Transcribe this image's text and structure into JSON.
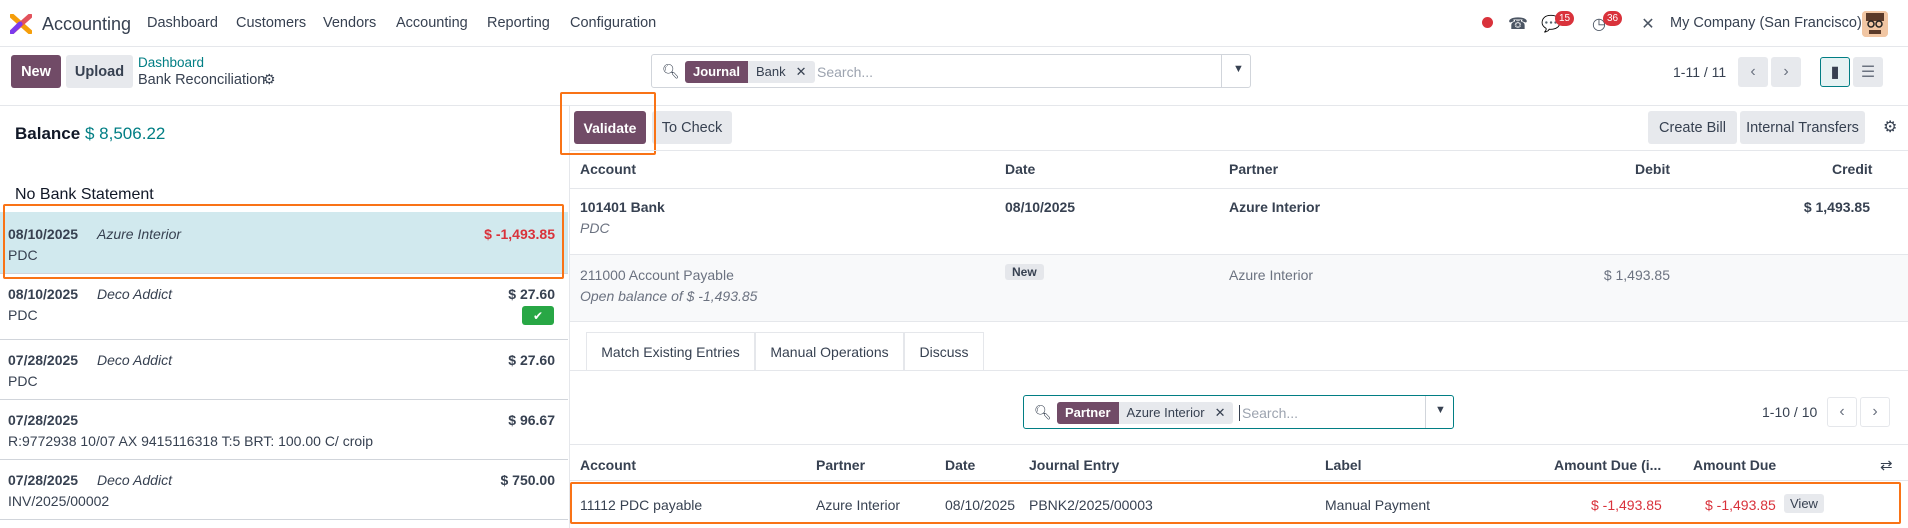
{
  "app": {
    "name": "Accounting"
  },
  "nav": {
    "items": [
      "Dashboard",
      "Customers",
      "Vendors",
      "Accounting",
      "Reporting",
      "Configuration"
    ]
  },
  "systray": {
    "messages_count": "15",
    "activities_count": "36",
    "company": "My Company (San Francisco)"
  },
  "control": {
    "new_label": "New",
    "upload_label": "Upload",
    "breadcrumb_parent": "Dashboard",
    "breadcrumb_current": "Bank Reconciliation",
    "search": {
      "facet_key": "Journal",
      "facet_value": "Bank",
      "placeholder": "Search..."
    },
    "pager": "1-11 / 11"
  },
  "left_panel": {
    "balance_label": "Balance",
    "balance_value": "$ 8,506.22",
    "statement_label": "No Bank Statement",
    "lines": [
      {
        "date": "08/10/2025",
        "partner": "Azure Interior",
        "amount": "$ -1,493.85",
        "ref": "PDC",
        "selected": true,
        "reconciled": false
      },
      {
        "date": "08/10/2025",
        "partner": "Deco Addict",
        "amount": "$ 27.60",
        "ref": "PDC",
        "selected": false,
        "reconciled": true
      },
      {
        "date": "07/28/2025",
        "partner": "Deco Addict",
        "amount": "$ 27.60",
        "ref": "PDC",
        "selected": false,
        "reconciled": false
      },
      {
        "date": "07/28/2025",
        "partner": "",
        "amount": "$ 96.67",
        "ref": "R:9772938 10/07 AX 9415116318 T:5 BRT: 100.00 C/ croip",
        "selected": false,
        "reconciled": false
      },
      {
        "date": "07/28/2025",
        "partner": "Deco Addict",
        "amount": "$ 750.00",
        "ref": "INV/2025/00002",
        "selected": false,
        "reconciled": false
      }
    ]
  },
  "right_panel": {
    "validate_label": "Validate",
    "to_check_label": "To Check",
    "create_bill_label": "Create Bill",
    "internal_transfers_label": "Internal Transfers",
    "columns": {
      "account": "Account",
      "date": "Date",
      "partner": "Partner",
      "debit": "Debit",
      "credit": "Credit"
    },
    "entries": [
      {
        "account": "101401 Bank",
        "sub": "PDC",
        "date": "08/10/2025",
        "partner": "Azure Interior",
        "debit": "",
        "credit": "$ 1,493.85"
      },
      {
        "account": "211000 Account Payable",
        "sub": "Open balance of $ -1,493.85",
        "date_badge": "New",
        "partner": "Azure Interior",
        "debit": "$ 1,493.85",
        "credit": ""
      }
    ],
    "tabs": [
      "Match Existing Entries",
      "Manual Operations",
      "Discuss"
    ],
    "match_search": {
      "facet_key": "Partner",
      "facet_value": "Azure Interior",
      "placeholder": "Search..."
    },
    "match_pager": "1-10 / 10",
    "match_columns": {
      "account": "Account",
      "partner": "Partner",
      "date": "Date",
      "journal_entry": "Journal Entry",
      "label": "Label",
      "amount_due_i": "Amount Due (i...",
      "amount_due": "Amount Due"
    },
    "match_rows": [
      {
        "account": "11112 PDC payable",
        "partner": "Azure Interior",
        "date": "08/10/2025",
        "journal_entry": "PBNK2/2025/00003",
        "label": "Manual Payment",
        "amount_due_i": "$ -1,493.85",
        "amount_due": "$ -1,493.85",
        "action": "View"
      }
    ]
  },
  "colors": {
    "primary": "#714b67",
    "teal": "#017e84",
    "danger": "#d9323b",
    "highlight": "#f97316",
    "selected_row": "#d1e9ee"
  }
}
